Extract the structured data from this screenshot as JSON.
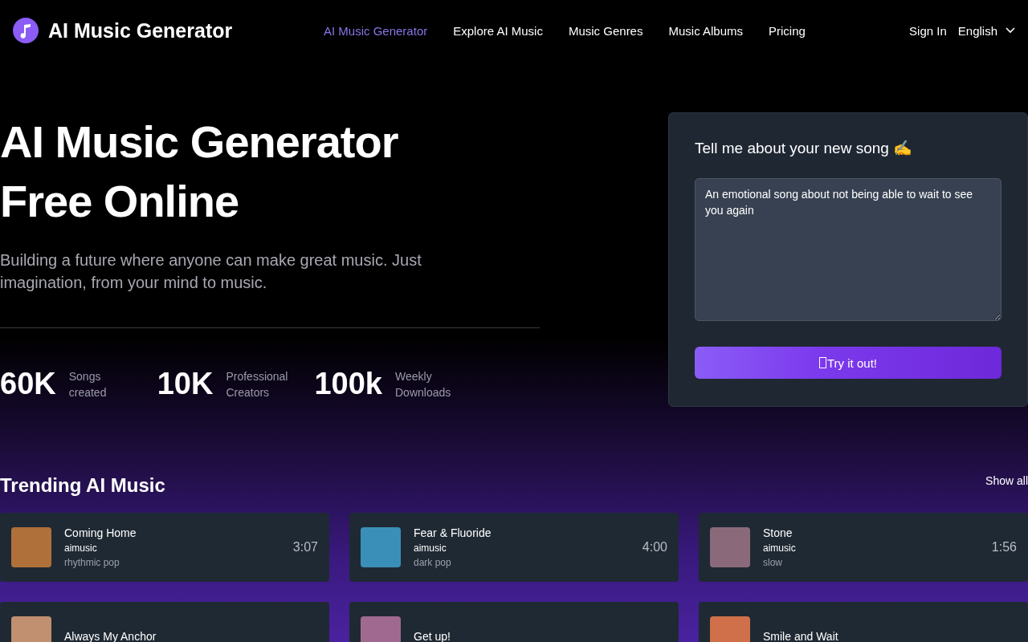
{
  "brand": {
    "name": "AI Music Generator"
  },
  "nav": [
    {
      "label": "AI Music Generator",
      "selected": true
    },
    {
      "label": "Explore AI Music",
      "selected": false
    },
    {
      "label": "Music Genres",
      "selected": false
    },
    {
      "label": "Music Albums",
      "selected": false
    },
    {
      "label": "Pricing",
      "selected": false
    }
  ],
  "account": {
    "sign_in": "Sign In",
    "language": "English"
  },
  "hero": {
    "title_lines": [
      "AI Music Generator",
      "Free Online"
    ],
    "subtitle": "Building a future where anyone can make great music. Just imagination, from your mind to music.",
    "stats": [
      {
        "value": "60K",
        "label": "Songs created"
      },
      {
        "value": "10K",
        "label": "Professional Creators"
      },
      {
        "value": "100k",
        "label": "Weekly Downloads"
      }
    ]
  },
  "prompt_card": {
    "title": "Tell me about your new song ✍",
    "value": "An emotional song about not being able to wait to see you again",
    "button": "Try it out!"
  },
  "trending": {
    "title": "Trending AI Music",
    "show_all": "Show all",
    "songs": [
      {
        "title": "Coming Home",
        "artist": "aimusic",
        "genre": "rhythmic pop",
        "duration": "3:07",
        "color": "#b0703a"
      },
      {
        "title": "Fear & Fluoride",
        "artist": "aimusic",
        "genre": "dark pop",
        "duration": "4:00",
        "color": "#3a8fb8"
      },
      {
        "title": "Stone",
        "artist": "aimusic",
        "genre": "slow",
        "duration": "1:56",
        "color": "#8a6a7a"
      },
      {
        "title": "Always My Anchor",
        "color": "#c09070"
      },
      {
        "title": "Get up!",
        "color": "#a06a90"
      },
      {
        "title": "Smile and Wait",
        "color": "#d0704a"
      }
    ]
  }
}
